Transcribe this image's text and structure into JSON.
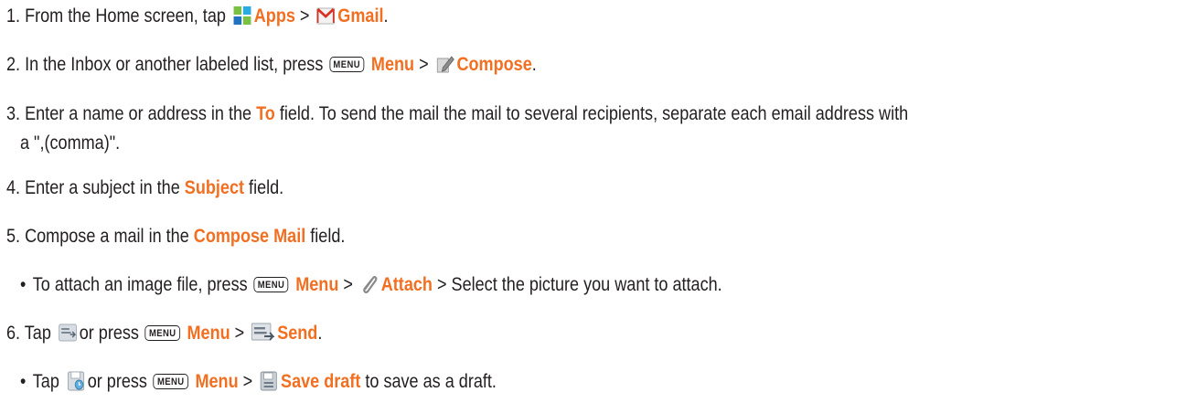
{
  "steps": {
    "s1": {
      "num": "1.",
      "text_a": "From the Home screen, tap",
      "kw_apps": "Apps",
      "sep": ">",
      "kw_gmail": "Gmail",
      "end": "."
    },
    "s2": {
      "num": "2.",
      "text_a": "In the Inbox or another labeled list, press",
      "key": "MENU",
      "kw_menu": "Menu",
      "sep": ">",
      "kw_compose": "Compose",
      "end": "."
    },
    "s3": {
      "num": "3.",
      "text_a": "Enter a name or address in the",
      "kw_to": "To",
      "text_b": "field. To send the mail the mail to several recipients, separate each email address with",
      "text_c": "a \",(comma)\"."
    },
    "s4": {
      "num": "4.",
      "text_a": "Enter a subject in the",
      "kw_subject": "Subject",
      "text_b": "field."
    },
    "s5": {
      "num": "5.",
      "text_a": "Compose a mail in the",
      "kw_compose_mail": "Compose Mail",
      "text_b": "field."
    },
    "b1": {
      "bullet": "•",
      "text_a": "To attach an image file, press",
      "key": "MENU",
      "kw_menu": "Menu",
      "sep": ">",
      "kw_attach": "Attach",
      "text_b": "> Select the picture you want to attach."
    },
    "s6": {
      "num": "6.",
      "text_a": "Tap",
      "text_b": "or press",
      "key": "MENU",
      "kw_menu": "Menu",
      "sep": ">",
      "kw_send": "Send",
      "end": "."
    },
    "b2": {
      "bullet": "•",
      "text_a": "Tap",
      "text_b": "or press",
      "key": "MENU",
      "kw_menu": "Menu",
      "sep": ">",
      "kw_save": "Save draft",
      "text_c": "to save as a draft."
    }
  },
  "icons": {
    "apps": "apps-grid-icon",
    "gmail": "gmail-envelope-icon",
    "compose": "compose-pencil-icon",
    "attach": "paperclip-icon",
    "send": "send-icon",
    "save": "save-draft-icon"
  },
  "colors": {
    "keyword": "#f26f21",
    "text": "#231f20"
  }
}
